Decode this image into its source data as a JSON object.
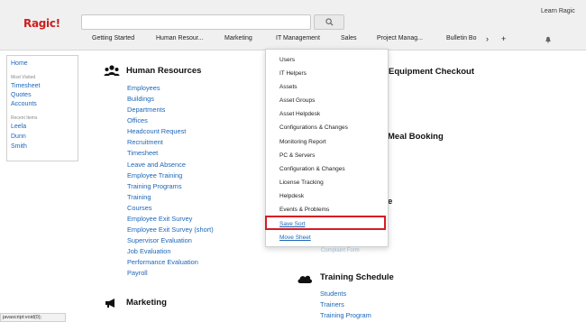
{
  "header": {
    "logo": "Ragic!",
    "search_placeholder": "",
    "learn_link": "Learn Ragic",
    "icons": {
      "search": "search-icon",
      "bell": "bell-icon"
    }
  },
  "tabs": [
    "Getting Started",
    "Human Resour...",
    "Marketing",
    "IT Management",
    "Sales",
    "Project Manag...",
    "Bulletin Bo"
  ],
  "tab_controls": {
    "more": "›",
    "add": "+"
  },
  "sidebar": {
    "home": "Home",
    "most_visited_caption": "Most Visited",
    "most_visited": [
      "Timesheet",
      "Quotes",
      "Accounts"
    ],
    "recent_caption": "Recent Items",
    "recent": [
      "Leela",
      "Dunn",
      "Smith"
    ]
  },
  "sections": {
    "hr": {
      "title": "Human Resources",
      "icon": "people-icon",
      "links": [
        "Employees",
        "Buildings",
        "Departments",
        "Offices",
        "Headcount Request",
        "Recruitment",
        "Timesheet",
        "Leave and Absence",
        "Employee Training",
        "Training Programs",
        "Training",
        "Courses",
        "Employee Exit Survey",
        "Employee Exit Survey (short)",
        "Supervisor Evaluation",
        "Job Evaluation",
        "Performance Evaluation",
        "Payroll"
      ]
    },
    "marketing": {
      "title": "Marketing",
      "icon": "megaphone-icon"
    },
    "equipment": {
      "title": "Equipment Checkout"
    },
    "meal": {
      "title": "Meal Booking"
    },
    "partial_title_fragment": "e",
    "partial_link": "Complaint Form",
    "training": {
      "title": "Training Schedule",
      "icon": "cloud-icon",
      "links": [
        "Students",
        "Trainers",
        "Training Program"
      ]
    }
  },
  "dropdown": {
    "items": [
      "Users",
      "IT Helpers",
      "Assets",
      "Asset Groups",
      "Asset Helpdesk",
      "Configurations & Changes",
      "Monitoring Report",
      "PC & Servers",
      "Configuration & Changes",
      "License Tracking",
      "Helpdesk",
      "Events & Problems"
    ],
    "save_sort": "Save Sort",
    "move_sheet": "Move Sheet",
    "highlight_color": "#d81b25"
  },
  "status_bar": "javascript:void(0);",
  "colors": {
    "link": "#1b66b8",
    "logo": "#cc1f1f",
    "header_bg": "#f0f0f0"
  }
}
